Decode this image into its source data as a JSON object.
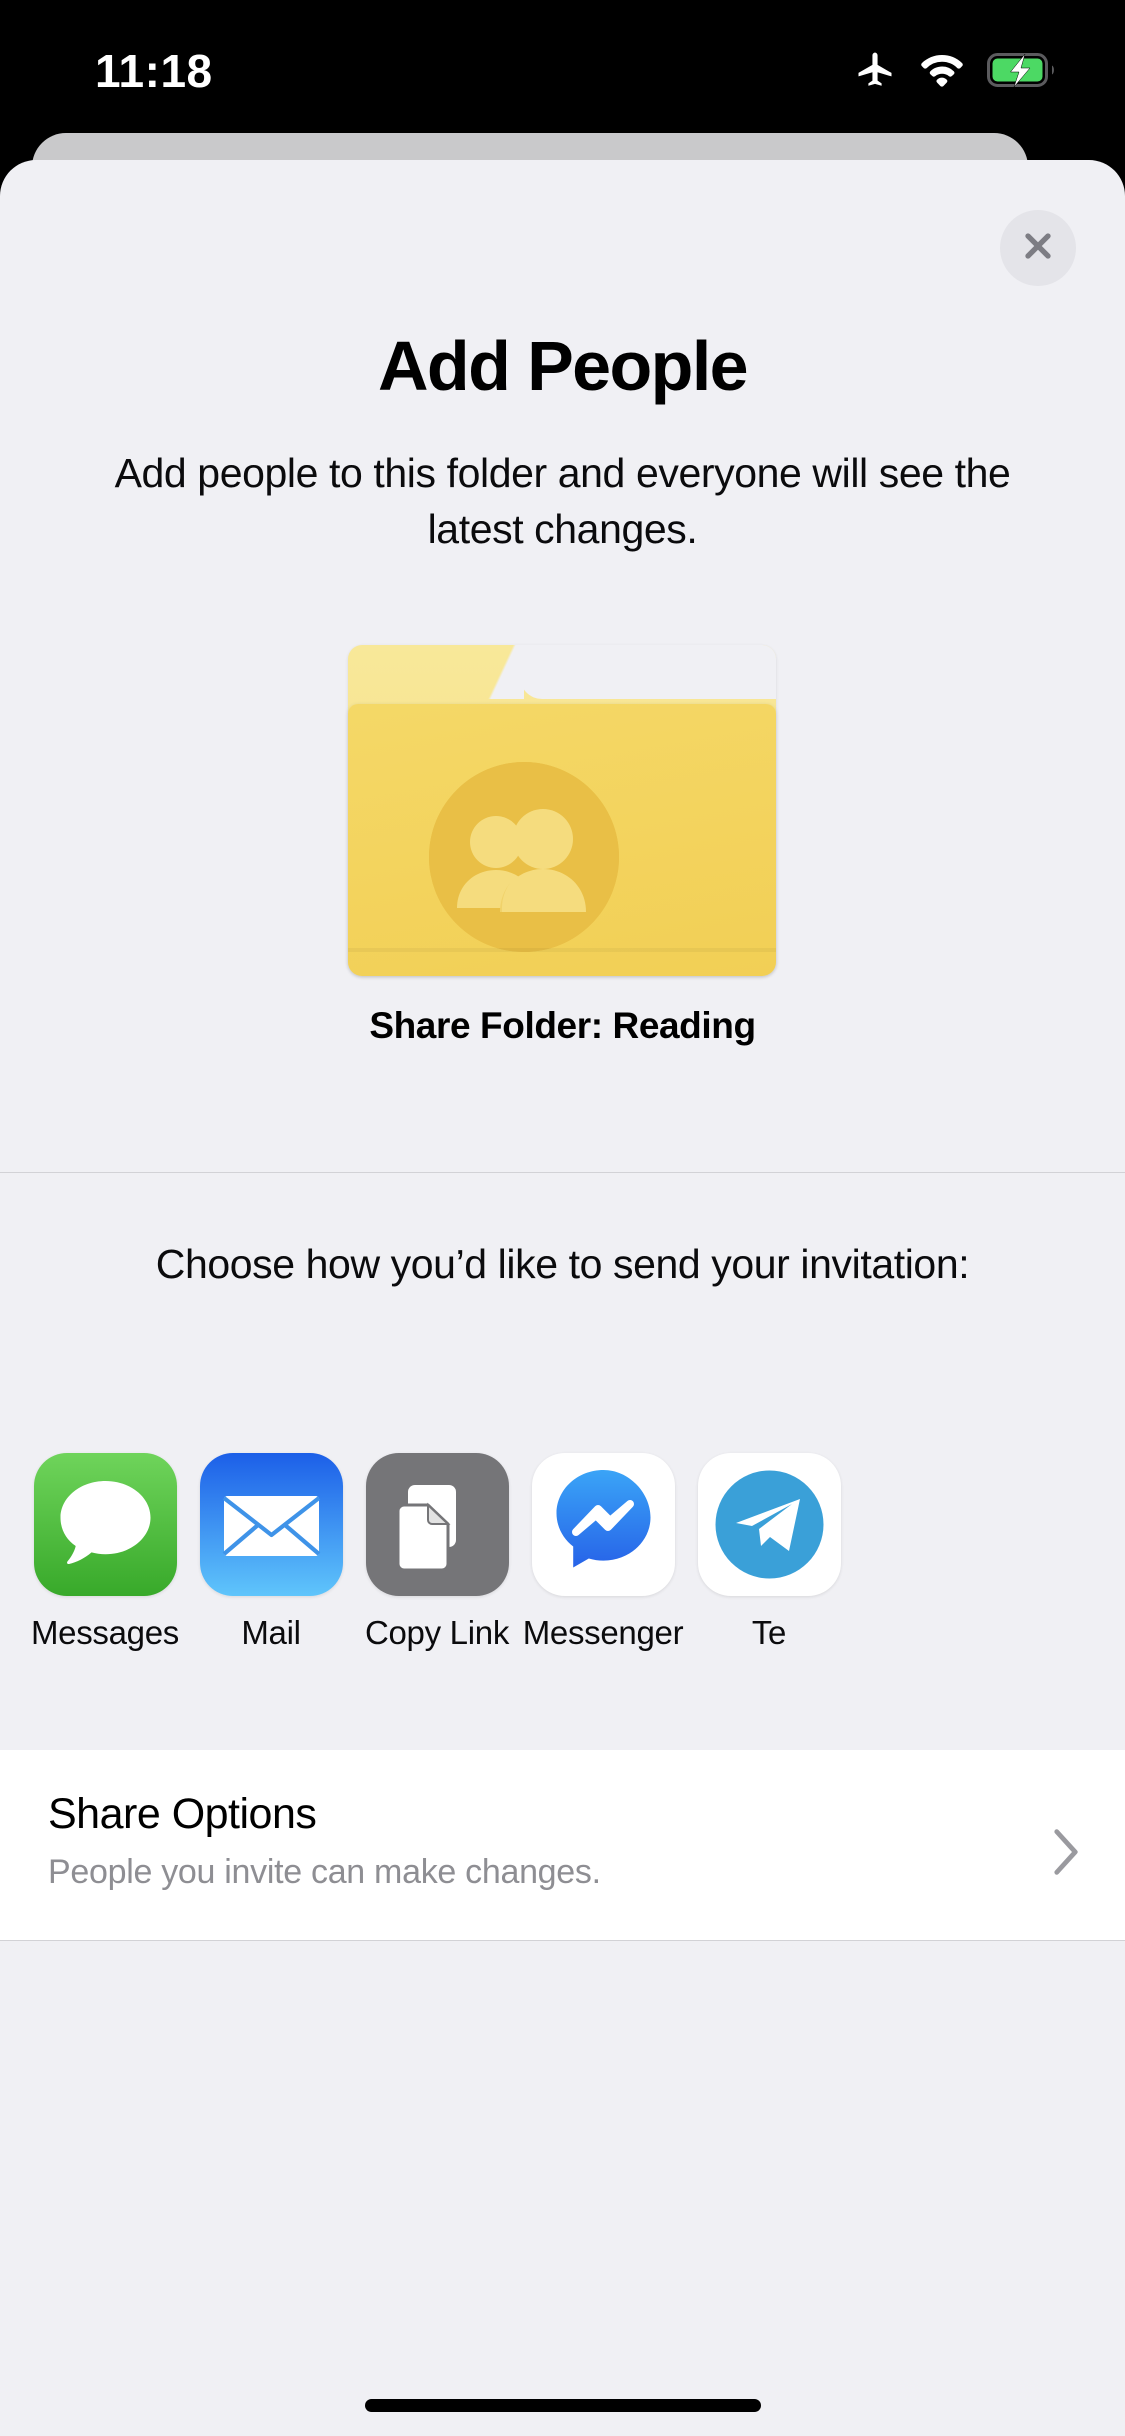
{
  "status_bar": {
    "time": "11:18",
    "icons": [
      "airplane-mode-icon",
      "wifi-icon",
      "battery-charging-icon"
    ],
    "battery_color": "#4cd964"
  },
  "sheet": {
    "background_color": "#f0f0f4",
    "close_label": "×",
    "close_icon": "close-icon",
    "title": "Add People",
    "subtitle": "Add people to this folder and everyone will see the latest changes.",
    "folder": {
      "icon": "shared-folder-icon",
      "badge_icon": "people-icon",
      "caption": "Share Folder: Reading",
      "tab_color": "#f6e28c",
      "body_color": "#f3d35d",
      "badge_color": "#e9bf46"
    },
    "share_prompt": "Choose how you’d like to send your invitation:",
    "apps": [
      {
        "label": "Messages",
        "icon": "messages-icon",
        "color": "#52c234"
      },
      {
        "label": "Mail",
        "icon": "mail-icon",
        "color": "#2a7df0"
      },
      {
        "label": "Copy Link",
        "icon": "copy-link-icon",
        "color": "#757578"
      },
      {
        "label": "Messenger",
        "icon": "messenger-icon",
        "color": "#2b7ef2"
      },
      {
        "label": "Te",
        "icon": "telegram-icon",
        "color": "#3aa0d8"
      }
    ],
    "share_options": {
      "title": "Share Options",
      "subtitle": "People you invite can make changes.",
      "chevron_icon": "chevron-right-icon"
    }
  },
  "home_indicator": {
    "present": true
  }
}
